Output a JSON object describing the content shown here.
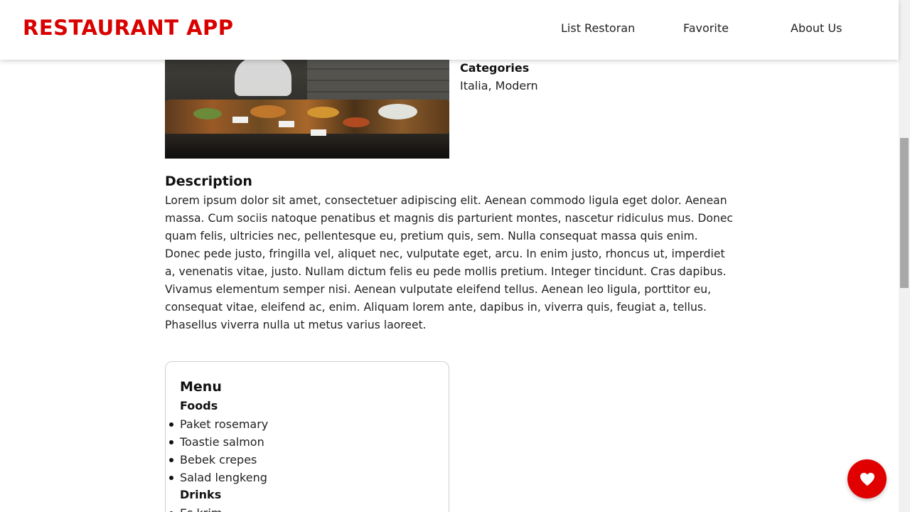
{
  "app": {
    "brand": "RESTAURANT APP",
    "brand_color": "#d90000"
  },
  "nav": {
    "items": [
      "List Restoran",
      "Favorite",
      "About Us"
    ]
  },
  "restaurant": {
    "categories_label": "Categories",
    "categories_value": "Italia, Modern",
    "description_title": "Description",
    "description_text": "Lorem ipsum dolor sit amet, consectetuer adipiscing elit. Aenean commodo ligula eget dolor. Aenean massa. Cum sociis natoque penatibus et magnis dis parturient montes, nascetur ridiculus mus. Donec quam felis, ultricies nec, pellentesque eu, pretium quis, sem. Nulla consequat massa quis enim. Donec pede justo, fringilla vel, aliquet nec, vulputate eget, arcu. In enim justo, rhoncus ut, imperdiet a, venenatis vitae, justo. Nullam dictum felis eu pede mollis pretium. Integer tincidunt. Cras dapibus. Vivamus elementum semper nisi. Aenean vulputate eleifend tellus. Aenean leo ligula, porttitor eu, consequat vitae, eleifend ac, enim. Aliquam lorem ante, dapibus in, viverra quis, feugiat a, tellus. Phasellus viverra nulla ut metus varius laoreet."
  },
  "menu": {
    "title": "Menu",
    "foods_label": "Foods",
    "foods": [
      "Paket rosemary",
      "Toastie salmon",
      "Bebek crepes",
      "Salad lengkeng"
    ],
    "drinks_label": "Drinks",
    "drinks": [
      "Es krim"
    ]
  },
  "fab": {
    "icon": "heart-icon",
    "color": "#e00000"
  }
}
